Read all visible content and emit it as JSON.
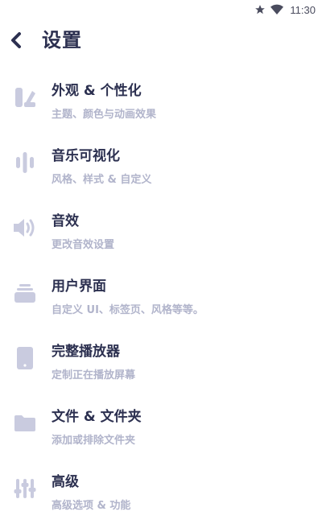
{
  "status_bar": {
    "time": "11:30",
    "icons": [
      "star-icon",
      "wifi-icon"
    ]
  },
  "header": {
    "title": "设置",
    "back_icon": "chevron-left-icon"
  },
  "colors": {
    "title": "#2c3050",
    "subtitle": "#b1b4cb",
    "icon": "#c9cbdf",
    "background": "#ffffff"
  },
  "settings": {
    "items": [
      {
        "icon": "palette-icon",
        "title": "外观 & 个性化",
        "subtitle": "主题、颜色与动画效果"
      },
      {
        "icon": "visualizer-icon",
        "title": "音乐可视化",
        "subtitle": "风格、样式 & 自定义"
      },
      {
        "icon": "speaker-icon",
        "title": "音效",
        "subtitle": "更改音效设置"
      },
      {
        "icon": "layers-icon",
        "title": "用户界面",
        "subtitle": "自定义 UI、标签页、风格等等。"
      },
      {
        "icon": "tablet-icon",
        "title": "完整播放器",
        "subtitle": "定制正在播放屏幕"
      },
      {
        "icon": "folder-icon",
        "title": "文件 & 文件夹",
        "subtitle": "添加或排除文件夹"
      },
      {
        "icon": "sliders-icon",
        "title": "高级",
        "subtitle": "高级选项 & 功能"
      }
    ]
  }
}
